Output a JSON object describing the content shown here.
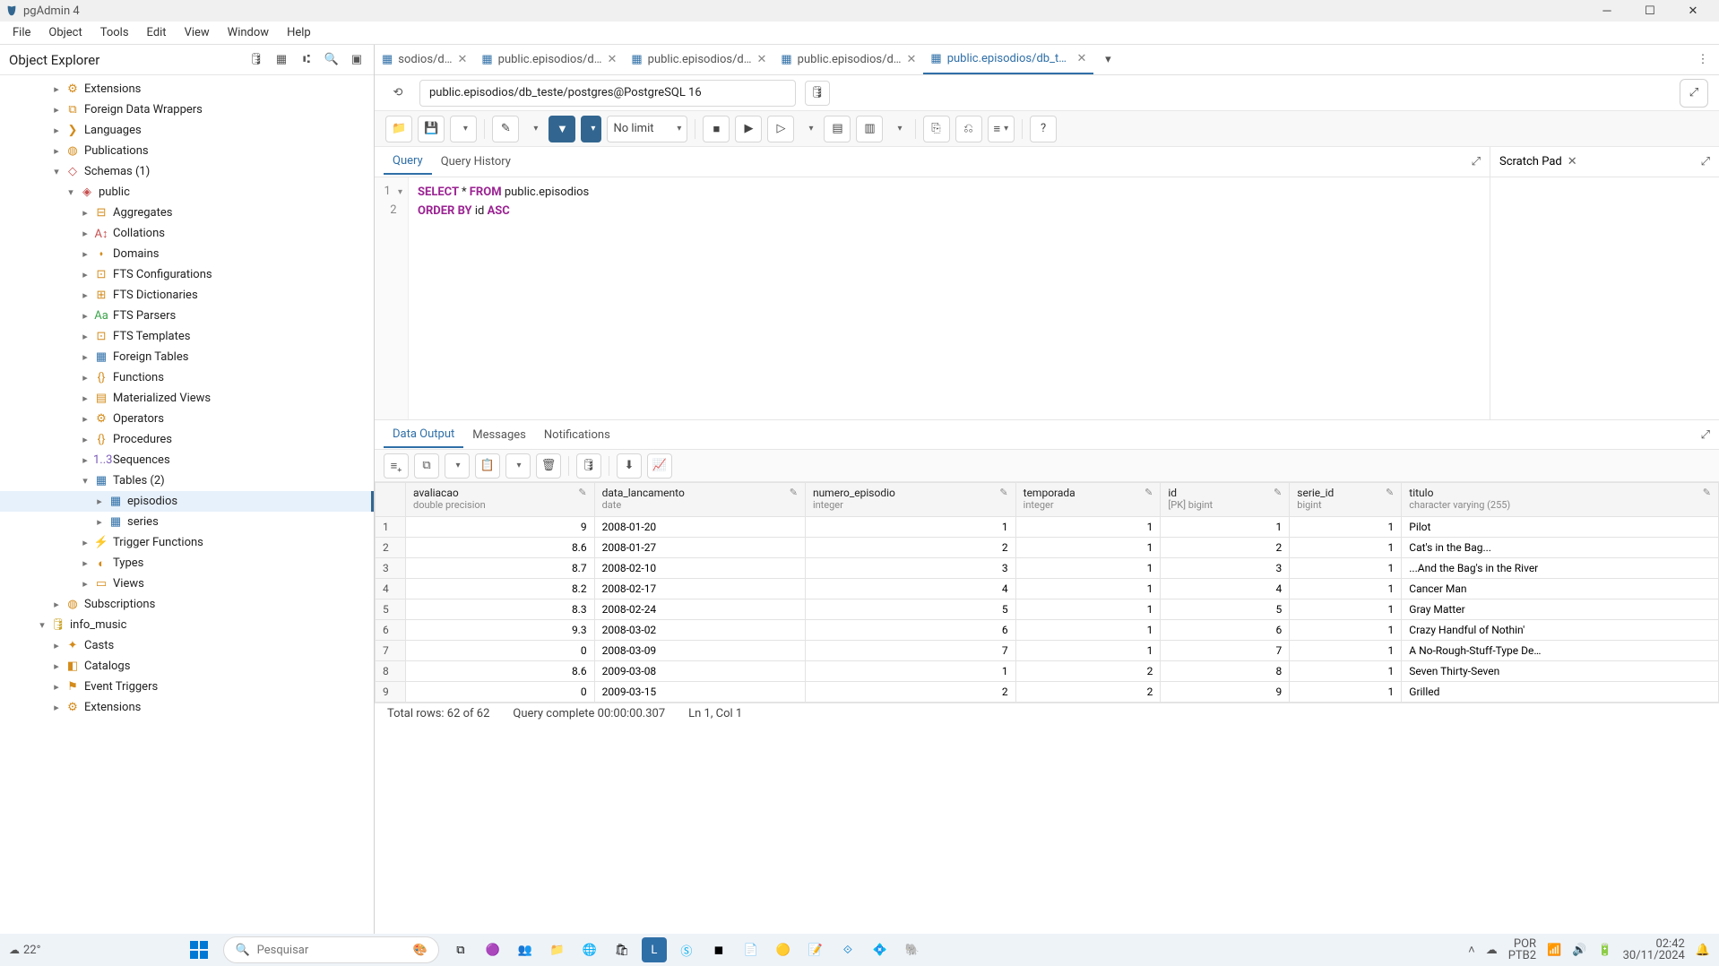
{
  "window": {
    "title": "pgAdmin 4"
  },
  "menubar": [
    "File",
    "Object",
    "Tools",
    "Edit",
    "View",
    "Window",
    "Help"
  ],
  "sidebar": {
    "title": "Object Explorer",
    "tools": [
      "query-tool-icon",
      "rows-icon",
      "filter-icon",
      "search-icon",
      "terminal-icon"
    ],
    "nodes": [
      {
        "indent": 3,
        "chev": "▸",
        "ico": "⚙",
        "icoClass": "c-orange",
        "label": "Extensions"
      },
      {
        "indent": 3,
        "chev": "▸",
        "ico": "⧉",
        "icoClass": "c-orange",
        "label": "Foreign Data Wrappers"
      },
      {
        "indent": 3,
        "chev": "▸",
        "ico": "❯",
        "icoClass": "c-orange",
        "label": "Languages"
      },
      {
        "indent": 3,
        "chev": "▸",
        "ico": "◍",
        "icoClass": "c-orange",
        "label": "Publications"
      },
      {
        "indent": 3,
        "chev": "▾",
        "ico": "◇",
        "icoClass": "c-red",
        "label": "Schemas (1)"
      },
      {
        "indent": 4,
        "chev": "▾",
        "ico": "◈",
        "icoClass": "c-red",
        "label": "public"
      },
      {
        "indent": 5,
        "chev": "▸",
        "ico": "⊟",
        "icoClass": "c-orange",
        "label": "Aggregates"
      },
      {
        "indent": 5,
        "chev": "▸",
        "ico": "A↕",
        "icoClass": "c-red",
        "label": "Collations"
      },
      {
        "indent": 5,
        "chev": "▸",
        "ico": "⬪",
        "icoClass": "c-orange",
        "label": "Domains"
      },
      {
        "indent": 5,
        "chev": "▸",
        "ico": "⊡",
        "icoClass": "c-orange",
        "label": "FTS Configurations"
      },
      {
        "indent": 5,
        "chev": "▸",
        "ico": "⊞",
        "icoClass": "c-orange",
        "label": "FTS Dictionaries"
      },
      {
        "indent": 5,
        "chev": "▸",
        "ico": "Aa",
        "icoClass": "c-green",
        "label": "FTS Parsers"
      },
      {
        "indent": 5,
        "chev": "▸",
        "ico": "⊡",
        "icoClass": "c-orange",
        "label": "FTS Templates"
      },
      {
        "indent": 5,
        "chev": "▸",
        "ico": "▦",
        "icoClass": "c-blue",
        "label": "Foreign Tables"
      },
      {
        "indent": 5,
        "chev": "▸",
        "ico": "{}",
        "icoClass": "c-orange",
        "label": "Functions"
      },
      {
        "indent": 5,
        "chev": "▸",
        "ico": "▤",
        "icoClass": "c-orange",
        "label": "Materialized Views"
      },
      {
        "indent": 5,
        "chev": "▸",
        "ico": "⚙",
        "icoClass": "c-orange",
        "label": "Operators"
      },
      {
        "indent": 5,
        "chev": "▸",
        "ico": "{}",
        "icoClass": "c-orange",
        "label": "Procedures"
      },
      {
        "indent": 5,
        "chev": "▸",
        "ico": "1..3",
        "icoClass": "c-purple",
        "label": "Sequences"
      },
      {
        "indent": 5,
        "chev": "▾",
        "ico": "▦",
        "icoClass": "c-blue",
        "label": "Tables (2)"
      },
      {
        "indent": 6,
        "chev": "▸",
        "ico": "▦",
        "icoClass": "c-blue",
        "label": "episodios",
        "selected": true
      },
      {
        "indent": 6,
        "chev": "▸",
        "ico": "▦",
        "icoClass": "c-blue",
        "label": "series"
      },
      {
        "indent": 5,
        "chev": "▸",
        "ico": "⚡",
        "icoClass": "c-orange",
        "label": "Trigger Functions"
      },
      {
        "indent": 5,
        "chev": "▸",
        "ico": "◐",
        "icoClass": "c-orange",
        "label": "Types"
      },
      {
        "indent": 5,
        "chev": "▸",
        "ico": "▭",
        "icoClass": "c-orange",
        "label": "Views"
      },
      {
        "indent": 3,
        "chev": "▸",
        "ico": "◍",
        "icoClass": "c-orange",
        "label": "Subscriptions"
      },
      {
        "indent": 2,
        "chev": "▾",
        "ico": "🛢",
        "icoClass": "c-yellow",
        "label": "info_music"
      },
      {
        "indent": 3,
        "chev": "▸",
        "ico": "✦",
        "icoClass": "c-orange",
        "label": "Casts"
      },
      {
        "indent": 3,
        "chev": "▸",
        "ico": "◧",
        "icoClass": "c-orange",
        "label": "Catalogs"
      },
      {
        "indent": 3,
        "chev": "▸",
        "ico": "⚑",
        "icoClass": "c-orange",
        "label": "Event Triggers"
      },
      {
        "indent": 3,
        "chev": "▸",
        "ico": "⚙",
        "icoClass": "c-orange",
        "label": "Extensions"
      }
    ]
  },
  "tabs": [
    {
      "icon": "▦",
      "label": "sodios/d…",
      "active": false
    },
    {
      "icon": "▦",
      "label": "public.episodios/d…",
      "active": false
    },
    {
      "icon": "▦",
      "label": "public.episodios/d…",
      "active": false
    },
    {
      "icon": "▦",
      "label": "public.episodios/d…",
      "active": false
    },
    {
      "icon": "▦",
      "label": "public.episodios/db_teste/postgres@PostgreSQL 16",
      "active": true
    }
  ],
  "connection": {
    "value": "public.episodios/db_teste/postgres@PostgreSQL 16"
  },
  "toolbar": {
    "nolimit": "No limit"
  },
  "queryTabs": {
    "query": "Query",
    "history": "Query History"
  },
  "code": {
    "line1_pre": "SELECT ",
    "line1_star": "* ",
    "line1_from": "FROM ",
    "line1_id": "public.episodios",
    "line2_pre": "ORDER BY ",
    "line2_id": "id ",
    "line2_asc": "ASC"
  },
  "scratch": {
    "title": "Scratch Pad"
  },
  "resultTabs": {
    "data": "Data Output",
    "messages": "Messages",
    "notifications": "Notifications"
  },
  "columns": [
    {
      "key": "avaliacao",
      "name": "avaliacao",
      "type": "double precision",
      "align": "num"
    },
    {
      "key": "data_lancamento",
      "name": "data_lancamento",
      "type": "date",
      "align": ""
    },
    {
      "key": "numero_episodio",
      "name": "numero_episodio",
      "type": "integer",
      "align": "num"
    },
    {
      "key": "temporada",
      "name": "temporada",
      "type": "integer",
      "align": "num"
    },
    {
      "key": "id",
      "name": "id",
      "type": "[PK] bigint",
      "align": "num"
    },
    {
      "key": "serie_id",
      "name": "serie_id",
      "type": "bigint",
      "align": "num"
    },
    {
      "key": "titulo",
      "name": "titulo",
      "type": "character varying (255)",
      "align": ""
    }
  ],
  "rows": [
    {
      "n": "1",
      "avaliacao": "9",
      "data_lancamento": "2008-01-20",
      "numero_episodio": "1",
      "temporada": "1",
      "id": "1",
      "serie_id": "1",
      "titulo": "Pilot"
    },
    {
      "n": "2",
      "avaliacao": "8.6",
      "data_lancamento": "2008-01-27",
      "numero_episodio": "2",
      "temporada": "1",
      "id": "2",
      "serie_id": "1",
      "titulo": "Cat's in the Bag..."
    },
    {
      "n": "3",
      "avaliacao": "8.7",
      "data_lancamento": "2008-02-10",
      "numero_episodio": "3",
      "temporada": "1",
      "id": "3",
      "serie_id": "1",
      "titulo": "...And the Bag's in the River"
    },
    {
      "n": "4",
      "avaliacao": "8.2",
      "data_lancamento": "2008-02-17",
      "numero_episodio": "4",
      "temporada": "1",
      "id": "4",
      "serie_id": "1",
      "titulo": "Cancer Man"
    },
    {
      "n": "5",
      "avaliacao": "8.3",
      "data_lancamento": "2008-02-24",
      "numero_episodio": "5",
      "temporada": "1",
      "id": "5",
      "serie_id": "1",
      "titulo": "Gray Matter"
    },
    {
      "n": "6",
      "avaliacao": "9.3",
      "data_lancamento": "2008-03-02",
      "numero_episodio": "6",
      "temporada": "1",
      "id": "6",
      "serie_id": "1",
      "titulo": "Crazy Handful of Nothin'"
    },
    {
      "n": "7",
      "avaliacao": "0",
      "data_lancamento": "2008-03-09",
      "numero_episodio": "7",
      "temporada": "1",
      "id": "7",
      "serie_id": "1",
      "titulo": "A No-Rough-Stuff-Type De…"
    },
    {
      "n": "8",
      "avaliacao": "8.6",
      "data_lancamento": "2009-03-08",
      "numero_episodio": "1",
      "temporada": "2",
      "id": "8",
      "serie_id": "1",
      "titulo": "Seven Thirty-Seven"
    },
    {
      "n": "9",
      "avaliacao": "0",
      "data_lancamento": "2009-03-15",
      "numero_episodio": "2",
      "temporada": "2",
      "id": "9",
      "serie_id": "1",
      "titulo": "Grilled"
    }
  ],
  "status": {
    "total": "Total rows: 62 of 62",
    "time": "Query complete 00:00:00.307",
    "pos": "Ln 1, Col 1"
  },
  "taskbar": {
    "weather": "22°",
    "search_placeholder": "Pesquisar",
    "lang_top": "POR",
    "lang_bot": "PTB2",
    "time": "02:42",
    "date": "30/11/2024"
  }
}
